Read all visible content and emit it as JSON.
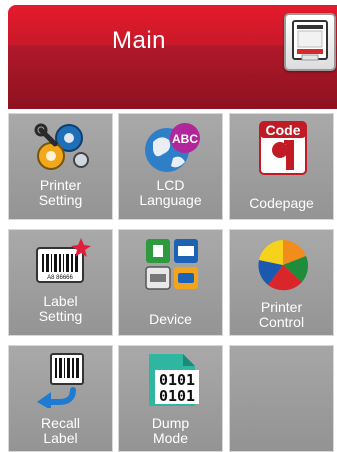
{
  "header": {
    "title": "Main"
  },
  "tiles": [
    {
      "line1": "Printer",
      "line2": "Setting",
      "icon": "gears-icon"
    },
    {
      "line1": "LCD",
      "line2": "Language",
      "icon": "globe-abc-icon"
    },
    {
      "line1": "Codepage",
      "line2": "",
      "icon": "code-pilcrow-icon"
    },
    {
      "line1": "Label",
      "line2": "Setting",
      "icon": "barcode-label-icon",
      "barcode_text": "A8 86666"
    },
    {
      "line1": "Device",
      "line2": "",
      "icon": "device-ports-icon"
    },
    {
      "line1": "Printer",
      "line2": "Control",
      "icon": "pie-chart-icon"
    },
    {
      "line1": "Recall",
      "line2": "Label",
      "icon": "recall-barcode-icon"
    },
    {
      "line1": "Dump",
      "line2": "Mode",
      "icon": "binary-file-icon",
      "file_text_1": "0101",
      "file_text_2": "0101"
    }
  ],
  "colors": {
    "header_red": "#c8192a",
    "tile_gray": "#9e9e9e",
    "label_white": "#ffffff"
  }
}
